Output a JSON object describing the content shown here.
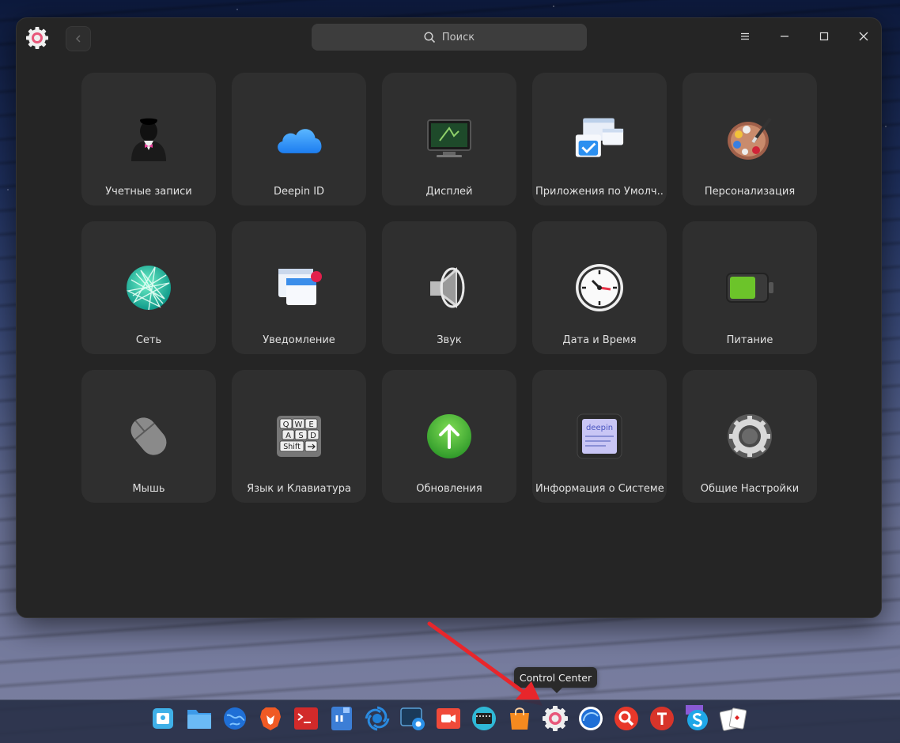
{
  "window": {
    "search_placeholder": "Поиск"
  },
  "tiles": [
    {
      "label": "Учетные записи",
      "icon": "accounts-icon"
    },
    {
      "label": "Deepin ID",
      "icon": "cloud-icon"
    },
    {
      "label": "Дисплей",
      "icon": "display-icon"
    },
    {
      "label": "Приложения по Умолч...",
      "icon": "default-apps-icon"
    },
    {
      "label": "Персонализация",
      "icon": "palette-icon"
    },
    {
      "label": "Сеть",
      "icon": "network-globe-icon"
    },
    {
      "label": "Уведомление",
      "icon": "notification-icon"
    },
    {
      "label": "Звук",
      "icon": "speaker-icon"
    },
    {
      "label": "Дата и Время",
      "icon": "clock-icon"
    },
    {
      "label": "Питание",
      "icon": "battery-icon"
    },
    {
      "label": "Мышь",
      "icon": "mouse-icon"
    },
    {
      "label": "Язык и  Клавиатура",
      "icon": "keyboard-icon"
    },
    {
      "label": "Обновления",
      "icon": "update-arrow-icon"
    },
    {
      "label": "Информация о Системе",
      "icon": "system-info-icon"
    },
    {
      "label": "Общие Настройки",
      "icon": "gear-icon"
    }
  ],
  "tiles_keyboard_keys": [
    "Q",
    "W",
    "E",
    "A",
    "S",
    "D",
    "Shift"
  ],
  "tiles_sysinfo_text": "deepin",
  "dock": {
    "tooltip": "Control Center",
    "items": [
      "launcher-icon",
      "file-manager-icon",
      "browser-icon",
      "brave-icon",
      "terminal-icon",
      "text-editor-icon",
      "deepin-icon",
      "screenshot-icon",
      "screen-recorder-icon",
      "video-player-icon",
      "app-store-icon",
      "control-center-icon",
      "system-monitor-icon",
      "search-app-icon",
      "font-manager-icon",
      "skype-icon",
      "solitaire-icon"
    ]
  },
  "colors": {
    "window_bg": "#252525",
    "tile_bg": "#2f2f2f",
    "accent_pink": "#e8577a",
    "update_green": "#4bb84b",
    "arrow_red": "#e8262b"
  }
}
